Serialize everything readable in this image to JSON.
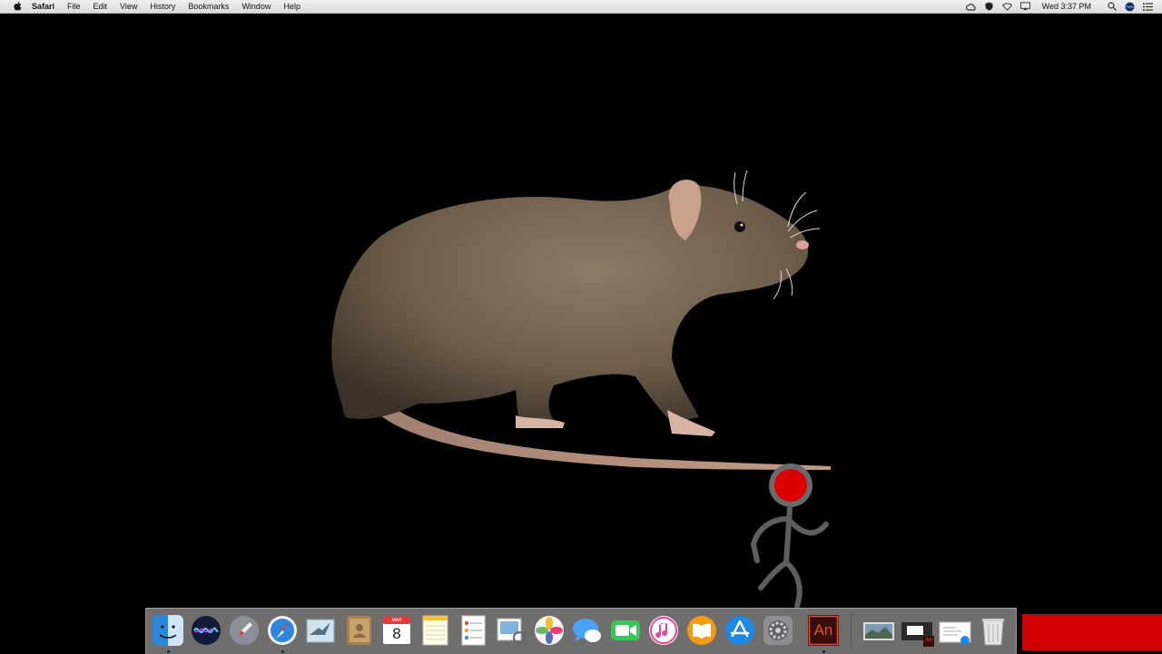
{
  "menubar": {
    "apple_icon": "apple-logo-icon",
    "app_name": "Safari",
    "menus": [
      "File",
      "Edit",
      "View",
      "History",
      "Bookmarks",
      "Window",
      "Help"
    ],
    "status_icons": [
      "creative-cloud-icon",
      "shield-icon",
      "wifi-icon",
      "airplay-display-icon"
    ],
    "clock": "Wed 3:37 PM",
    "right_icons": [
      "spotlight-search-icon",
      "siri-icon",
      "notification-center-icon"
    ]
  },
  "desktop": {
    "background_color": "#000000",
    "images": [
      "rat-photo",
      "stick-figure-red-head"
    ],
    "stick_figure_head_color": "#dd0000"
  },
  "dock": {
    "apps": [
      {
        "name": "Finder",
        "icon": "finder-icon",
        "running": true
      },
      {
        "name": "Siri",
        "icon": "siri-icon",
        "running": false
      },
      {
        "name": "Launchpad",
        "icon": "launchpad-icon",
        "running": false
      },
      {
        "name": "Safari",
        "icon": "safari-icon",
        "running": true
      },
      {
        "name": "Mail",
        "icon": "mail-icon",
        "running": false
      },
      {
        "name": "Contacts",
        "icon": "contacts-icon",
        "running": false
      },
      {
        "name": "Calendar",
        "icon": "calendar-icon",
        "running": false,
        "month": "MAR",
        "day": "8"
      },
      {
        "name": "Notes",
        "icon": "notes-icon",
        "running": false
      },
      {
        "name": "Reminders",
        "icon": "reminders-icon",
        "running": false
      },
      {
        "name": "Preview",
        "icon": "preview-icon",
        "running": false
      },
      {
        "name": "Photos",
        "icon": "photos-icon",
        "running": false
      },
      {
        "name": "Messages",
        "icon": "messages-icon",
        "running": false
      },
      {
        "name": "FaceTime",
        "icon": "facetime-icon",
        "running": false
      },
      {
        "name": "iTunes",
        "icon": "itunes-icon",
        "running": false
      },
      {
        "name": "iBooks",
        "icon": "ibooks-icon",
        "running": false
      },
      {
        "name": "App Store",
        "icon": "app-store-icon",
        "running": false
      },
      {
        "name": "System Preferences",
        "icon": "system-preferences-icon",
        "running": false
      },
      {
        "name": "Adobe Animate",
        "icon": "adobe-animate-icon",
        "running": true,
        "label": "An"
      }
    ],
    "stacks": [
      {
        "name": "Photo thumbnail",
        "icon": "photo-thumbnail-icon"
      },
      {
        "name": "Animate document",
        "icon": "animate-document-icon",
        "label": "An"
      },
      {
        "name": "Downloads",
        "icon": "downloads-stack-icon"
      },
      {
        "name": "Trash",
        "icon": "trash-icon"
      }
    ],
    "accent_block_color": "#d10000"
  }
}
